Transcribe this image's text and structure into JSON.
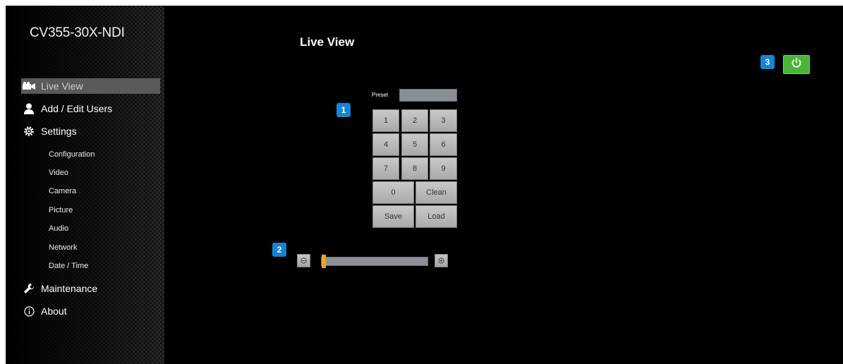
{
  "device_name": "CV355-30X-NDI",
  "page_title": "Live View",
  "nav": {
    "main": [
      {
        "label": "Live View",
        "icon": "video-camera-icon"
      },
      {
        "label": "Add / Edit Users",
        "icon": "user-icon"
      },
      {
        "label": "Settings",
        "icon": "gear-icon"
      },
      {
        "label": "Maintenance",
        "icon": "wrench-icon"
      },
      {
        "label": "About",
        "icon": "info-icon"
      }
    ],
    "settings_sub": [
      "Configuration",
      "Video",
      "Camera",
      "Picture",
      "Audio",
      "Network",
      "Date / Time"
    ]
  },
  "callouts": [
    "1",
    "2",
    "3"
  ],
  "preset": {
    "label": "Preset",
    "value": ""
  },
  "keypad": {
    "digits": [
      "1",
      "2",
      "3",
      "4",
      "5",
      "6",
      "7",
      "8",
      "9",
      "0"
    ],
    "clean": "Clean",
    "save": "Save",
    "load": "Load"
  },
  "zoom": {
    "level": 0.0
  },
  "colors": {
    "accent_callout": "#1a82d2",
    "power_button": "#4bb53a",
    "zoom_thumb": "#f4a21c"
  }
}
